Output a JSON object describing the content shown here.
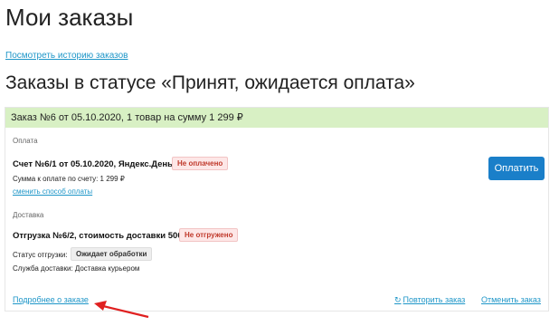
{
  "page": {
    "title": "Мои заказы",
    "history_link": "Посмотреть историю заказов",
    "section_title": "Заказы в статусе «Принят, ожидается оплата»"
  },
  "order": {
    "header": "Заказ №6 от 05.10.2020, 1 товар на сумму 1 299 ₽",
    "payment": {
      "label": "Оплата",
      "invoice_title": "Счет №6/1 от 05.10.2020, Яндекс.Деньги",
      "status_badge": "Не оплачено",
      "amount_text": "Сумма к оплате по счету: 1 299 ₽",
      "change_method_link": "сменить способ оплаты",
      "pay_button": "Оплатить"
    },
    "delivery": {
      "label": "Доставка",
      "shipment_title": "Отгрузка №6/2, стоимость доставки 500 ₽",
      "shipment_badge": "Не отгружено",
      "status_label": "Статус отгрузки:",
      "status_value": "Ожидает обработки",
      "service_text": "Служба доставки: Доставка курьером"
    },
    "footer": {
      "details_link": "Подробнее о заказе",
      "repeat_link": "Повторить заказ",
      "cancel_link": "Отменить заказ"
    }
  },
  "colors": {
    "link": "#1e96c8",
    "header_bg": "#d8f0c4",
    "button_bg": "#1a7fc9",
    "badge_red": "#c0392b",
    "arrow": "#e02020"
  },
  "icons": {
    "repeat": "repeat-icon",
    "annotation": "arrow-annotation"
  }
}
